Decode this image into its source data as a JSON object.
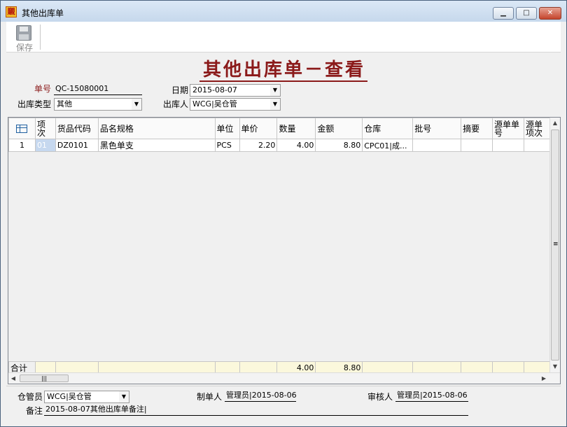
{
  "window": {
    "title": "其他出库单",
    "app_icon_glyph": "䞋",
    "min_glyph": "▁",
    "max_glyph": "□",
    "close_glyph": "✕"
  },
  "toolbar": {
    "save_label": "保存",
    "save_icon": "floppy-disk-icon"
  },
  "form": {
    "title": "其他出库单－查看",
    "doc_no_label": "单号",
    "doc_no": "QC-15080001",
    "date_label": "日期",
    "date": "2015-08-07",
    "out_type_label": "出库类型",
    "out_type": "其他",
    "out_person_label": "出库人",
    "out_person": "WCG|吴仓管"
  },
  "grid": {
    "headers": [
      "项次",
      "货品代码",
      "品名规格",
      "单位",
      "单价",
      "数量",
      "金额",
      "仓库",
      "批号",
      "摘要",
      "源单单号",
      "源单项次"
    ],
    "rows": [
      {
        "row_no": "1",
        "item": "01",
        "code": "DZ0101",
        "name": "黑色单支",
        "unit": "PCS",
        "price": "2.20",
        "qty": "4.00",
        "amount": "8.80",
        "warehouse": "CPC01|成...",
        "batch": "",
        "summary": "",
        "src_no": "",
        "src_item": ""
      }
    ],
    "total_label": "合计",
    "total_qty": "4.00",
    "total_amount": "8.80"
  },
  "scrollbars": {
    "up": "▲",
    "down": "▼",
    "left": "◀",
    "right": "▶",
    "grip_v": "≡",
    "grip_h": "|||"
  },
  "footer": {
    "keeper_label": "仓管员",
    "keeper": "WCG|吴仓管",
    "maker_label": "制单人",
    "maker": "管理员|2015-08-06",
    "auditor_label": "审核人",
    "auditor": "管理员|2015-08-06",
    "remark_label": "备注",
    "remark": "2015-08-07其他出库单备注|"
  },
  "colors": {
    "title_red": "#8b1a1a",
    "selection_blue": "#c6d8ef",
    "total_row": "#fbf8dc"
  }
}
